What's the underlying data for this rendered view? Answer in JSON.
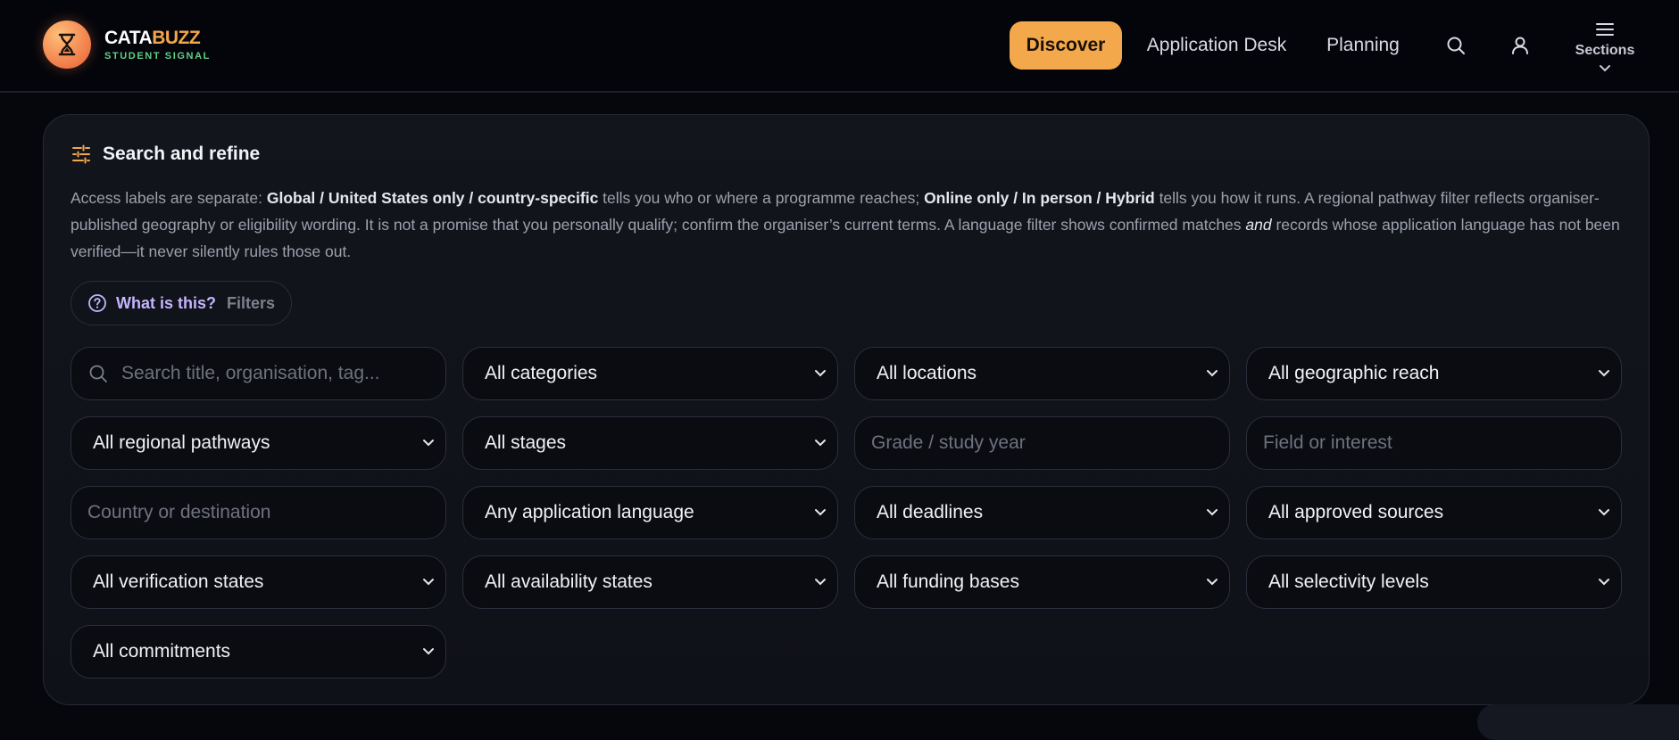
{
  "brand": {
    "name_part1": "CATA",
    "name_part2": "BUZZ",
    "tagline": "STUDENT SIGNAL",
    "logo_icon": "hourglass-icon"
  },
  "nav": {
    "items": [
      {
        "label": "Discover",
        "active": true
      },
      {
        "label": "Application Desk",
        "active": false
      },
      {
        "label": "Planning",
        "active": false
      }
    ],
    "search_icon": "search-icon",
    "account_icon": "user-icon",
    "sections_label": "Sections"
  },
  "panel": {
    "title": "Search and refine",
    "title_icon": "sliders-icon",
    "description": {
      "t1": "Access labels are separate: ",
      "b1": "Global / United States only / country-specific",
      "t2": " tells you who or where a programme reaches; ",
      "b2": "Online only / In person / Hybrid",
      "t3": " tells you how it runs. A regional pathway filter reflects organiser-published geography or eligibility wording. It is not a promise that you personally qualify; confirm the organiser’s current terms. A language filter shows confirmed matches ",
      "i1": "and",
      "t4": " records whose application language has not been verified—it never silently rules those out."
    },
    "help": {
      "question": "What is this?",
      "label": "Filters"
    }
  },
  "filters": {
    "search_placeholder": "Search title, organisation, tag...",
    "categories": "All categories",
    "locations": "All locations",
    "reach": "All geographic reach",
    "pathways": "All regional pathways",
    "stages": "All stages",
    "grade_placeholder": "Grade / study year",
    "field_placeholder": "Field or interest",
    "country_placeholder": "Country or destination",
    "language": "Any application language",
    "deadlines": "All deadlines",
    "sources": "All approved sources",
    "verification": "All verification states",
    "availability": "All availability states",
    "funding": "All funding bases",
    "selectivity": "All selectivity levels",
    "commitments": "All commitments"
  },
  "colors": {
    "accent": "#f4a84c",
    "brand_orange": "#f5a64a",
    "tagline_green": "#5fcf86",
    "help_purple": "#c4b4ff"
  }
}
